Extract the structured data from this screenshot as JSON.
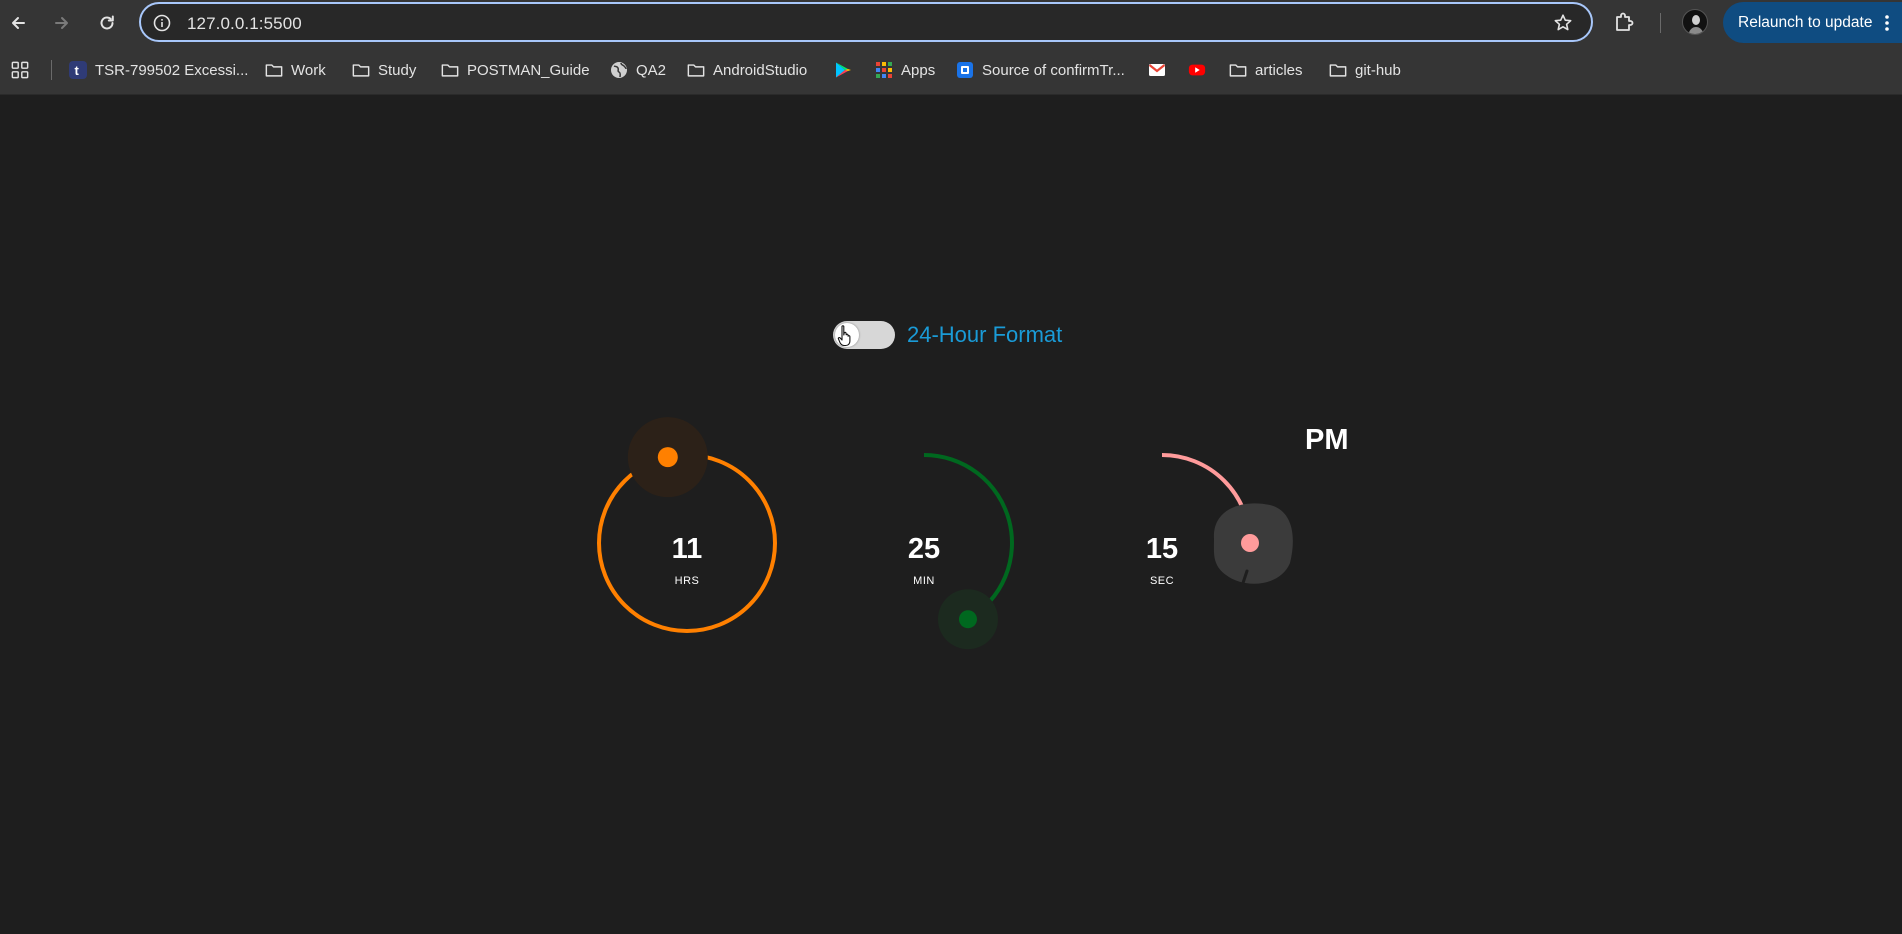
{
  "browser": {
    "url": "127.0.0.1:5500",
    "relaunch_label": "Relaunch to update",
    "bookmarks": [
      {
        "label": "",
        "icon": "apps-grid-icon"
      },
      {
        "label": "TSR-799502 Excessi...",
        "icon": "tumblr-icon"
      },
      {
        "label": "Work",
        "icon": "folder-icon"
      },
      {
        "label": "Study",
        "icon": "folder-icon"
      },
      {
        "label": "POSTMAN_Guide",
        "icon": "folder-icon"
      },
      {
        "label": "QA2",
        "icon": "globe-icon"
      },
      {
        "label": "AndroidStudio",
        "icon": "folder-icon"
      },
      {
        "label": "",
        "icon": "play-store-icon"
      },
      {
        "label": "Apps",
        "icon": "apps-grid-icon"
      },
      {
        "label": "Source of confirmTr...",
        "icon": "bookmark-app-icon"
      },
      {
        "label": "",
        "icon": "gmail-icon"
      },
      {
        "label": "",
        "icon": "youtube-icon"
      },
      {
        "label": "articles",
        "icon": "folder-icon"
      },
      {
        "label": "git-hub",
        "icon": "folder-icon"
      }
    ]
  },
  "clock": {
    "toggle_label": "24-Hour Format",
    "toggle_on": false,
    "period": "PM",
    "hours": {
      "value": "11",
      "unit": "HRS",
      "color": "#ff8000",
      "fraction": 1.0,
      "handle_fraction": 0.0
    },
    "minutes": {
      "value": "25",
      "unit": "MIN",
      "color": "#00681f",
      "fraction": 0.4167
    },
    "seconds": {
      "value": "15",
      "unit": "SEC",
      "color": "#ff9b9b",
      "fraction": 0.25
    }
  }
}
